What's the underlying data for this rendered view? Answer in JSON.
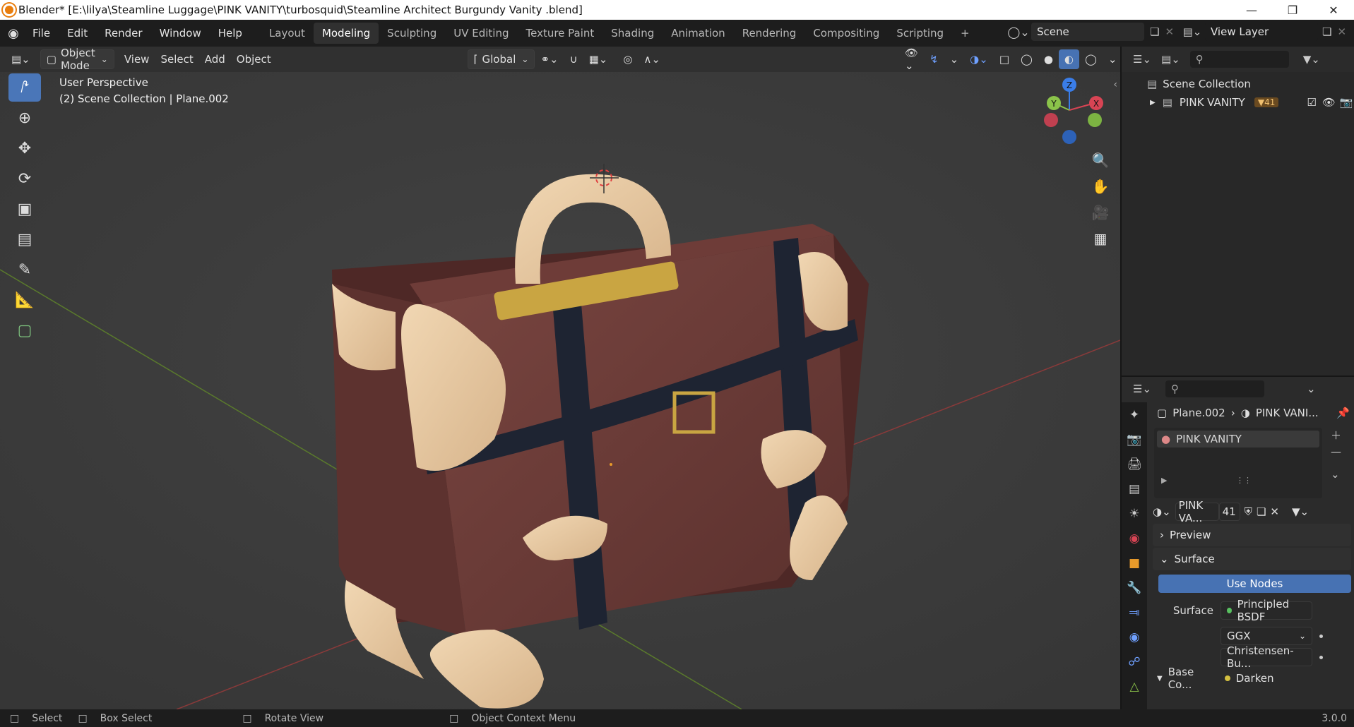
{
  "window": {
    "title": "Blender* [E:\\lilya\\Steamline Luggage\\PINK VANITY\\turbosquid\\Steamline Architect Burgundy Vanity .blend]"
  },
  "menubar": {
    "items": [
      "File",
      "Edit",
      "Render",
      "Window",
      "Help"
    ]
  },
  "workspaces": {
    "tabs": [
      "Layout",
      "Modeling",
      "Sculpting",
      "UV Editing",
      "Texture Paint",
      "Shading",
      "Animation",
      "Rendering",
      "Compositing",
      "Scripting"
    ],
    "active": "Modeling",
    "add_label": "+"
  },
  "scene": {
    "label": "Scene"
  },
  "view_layer": {
    "label": "View Layer"
  },
  "viewport_header": {
    "mode": "Object Mode",
    "menus": [
      "View",
      "Select",
      "Add",
      "Object"
    ],
    "transform_orientation": "Global"
  },
  "viewport": {
    "perspective": "User Perspective",
    "collection_info": "(2) Scene Collection | Plane.002",
    "gizmo": {
      "x": "X",
      "y": "Y",
      "z": "Z"
    }
  },
  "outliner": {
    "root": "Scene Collection",
    "items": [
      {
        "name": "PINK VANITY",
        "badge": "41"
      }
    ]
  },
  "properties": {
    "breadcrumb": {
      "object": "Plane.002",
      "material": "PINK VANI..."
    },
    "material_slot": "PINK VANITY",
    "material_name": "PINK VA...",
    "material_users": "41",
    "sections": {
      "preview": "Preview",
      "surface": "Surface"
    },
    "use_nodes_label": "Use Nodes",
    "surface_label": "Surface",
    "surface_shader": "Principled BSDF",
    "distribution": "GGX",
    "subsurface_method": "Christensen-Bu...",
    "base_color_label": "Base Co...",
    "base_color_value": "Darken"
  },
  "statusbar": {
    "select": "Select",
    "box_select": "Box Select",
    "rotate_view": "Rotate View",
    "context_menu": "Object Context Menu",
    "version": "3.0.0"
  },
  "colors": {
    "accent": "#4772b3",
    "active_tool": "#4a76b8",
    "axis_x": "#d84454",
    "axis_y": "#8bc34a",
    "axis_z": "#3a7de8",
    "case_body": "#6b3a36",
    "case_leather": "#e8c9a2",
    "case_strap": "#1e2432",
    "case_brass": "#c9a542"
  }
}
